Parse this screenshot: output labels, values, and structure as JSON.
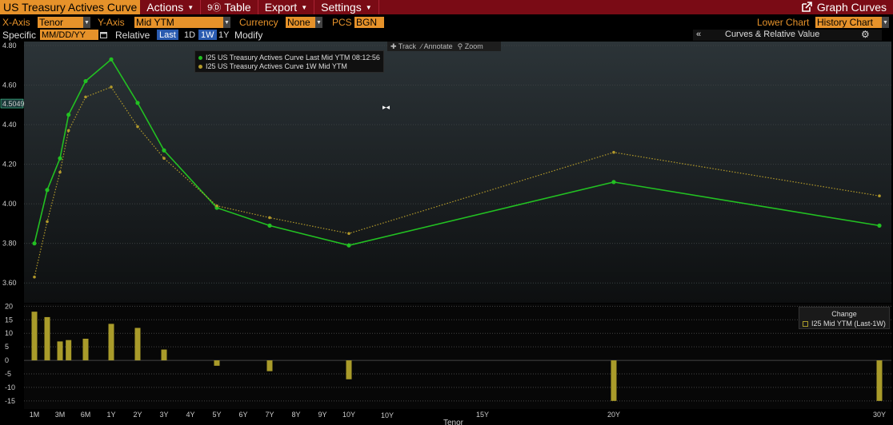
{
  "menubar": {
    "title": "US Treasury Actives Curve",
    "actions": "Actions",
    "table_icon": "9Ⓓ",
    "table": "Table",
    "export": "Export",
    "settings": "Settings",
    "graph_curves": "Graph Curves"
  },
  "controls": {
    "xaxis_label": "X-Axis",
    "xaxis_value": "Tenor",
    "yaxis_label": "Y-Axis",
    "yaxis_value": "Mid YTM",
    "currency_label": "Currency",
    "currency_value": "None",
    "pcs_label": "PCS",
    "pcs_value": "BGN",
    "lower_chart_label": "Lower Chart",
    "lower_chart_value": "History Chart"
  },
  "row3": {
    "specific": "Specific",
    "date_placeholder": "MM/DD/YY",
    "relative": "Relative",
    "btn_last": "Last",
    "btn_1d": "1D",
    "btn_1w": "1W",
    "btn_1y": "1Y",
    "modify": "Modify",
    "collapse": "«",
    "curves_rv": "Curves & Relative Value",
    "gear": "⚙"
  },
  "toolbar": {
    "track": "Track",
    "annotate": "Annotate",
    "zoom": "Zoom"
  },
  "legend_upper": {
    "series1": "I25 US Treasury Actives Curve Last Mid YTM 08:12:56",
    "series2": "I25 US Treasury Actives Curve 1W Mid YTM"
  },
  "legend_lower": {
    "title": "Change",
    "series": "I25 Mid YTM (Last-1W)"
  },
  "xaxis_title": "Tenor",
  "colors": {
    "last": "#22c022",
    "week": "#b39a2a",
    "bar": "#a99b2a",
    "menubar": "#7a0b15",
    "accent": "#e6922a"
  },
  "chart_data": {
    "type": "line",
    "x_scale": "tenor (months, non-linear spacing)",
    "tick_labels": [
      "1M",
      "3M",
      "6M",
      "1Y",
      "2Y",
      "3Y",
      "4Y",
      "5Y",
      "6Y",
      "7Y",
      "8Y",
      "9Y",
      "10Y",
      "15Y",
      "20Y",
      "30Y"
    ],
    "tick_months": [
      1,
      3,
      6,
      12,
      24,
      36,
      48,
      60,
      72,
      84,
      96,
      108,
      120,
      180,
      240,
      360
    ],
    "highlight_tick": "10Y",
    "y_ticks": [
      3.6,
      3.8,
      4.0,
      4.2,
      4.4,
      4.6,
      4.8
    ],
    "ylim": [
      3.5,
      4.82
    ],
    "y_current_label": "4.5049",
    "y_current_value": 4.5049,
    "series": [
      {
        "name": "I25 US Treasury Actives Curve Last Mid YTM 08:12:56",
        "style": "solid",
        "x_months": [
          1,
          2,
          3,
          4,
          6,
          12,
          24,
          36,
          60,
          84,
          120,
          240,
          360
        ],
        "values": [
          3.8,
          4.07,
          4.23,
          4.45,
          4.62,
          4.73,
          4.51,
          4.27,
          3.98,
          3.89,
          3.79,
          4.11,
          3.89
        ]
      },
      {
        "name": "I25 US Treasury Actives Curve 1W Mid YTM",
        "style": "dotted",
        "x_months": [
          1,
          2,
          3,
          4,
          6,
          12,
          24,
          36,
          60,
          84,
          120,
          240,
          360
        ],
        "values": [
          3.63,
          3.91,
          4.16,
          4.37,
          4.54,
          4.59,
          4.39,
          4.23,
          3.99,
          3.93,
          3.85,
          4.26,
          4.04
        ]
      }
    ],
    "lower": {
      "type": "bar",
      "name": "I25 Mid YTM (Last-1W)",
      "y_ticks": [
        20,
        15,
        10,
        5,
        0,
        -5,
        -10,
        -15
      ],
      "ylim": [
        -18,
        21
      ],
      "x_months": [
        1,
        2,
        3,
        4,
        6,
        12,
        24,
        36,
        60,
        84,
        120,
        240,
        360
      ],
      "values": [
        18,
        16,
        7,
        7.5,
        8,
        13.5,
        12,
        4,
        -2,
        -4,
        -7,
        -15,
        -15
      ]
    }
  }
}
